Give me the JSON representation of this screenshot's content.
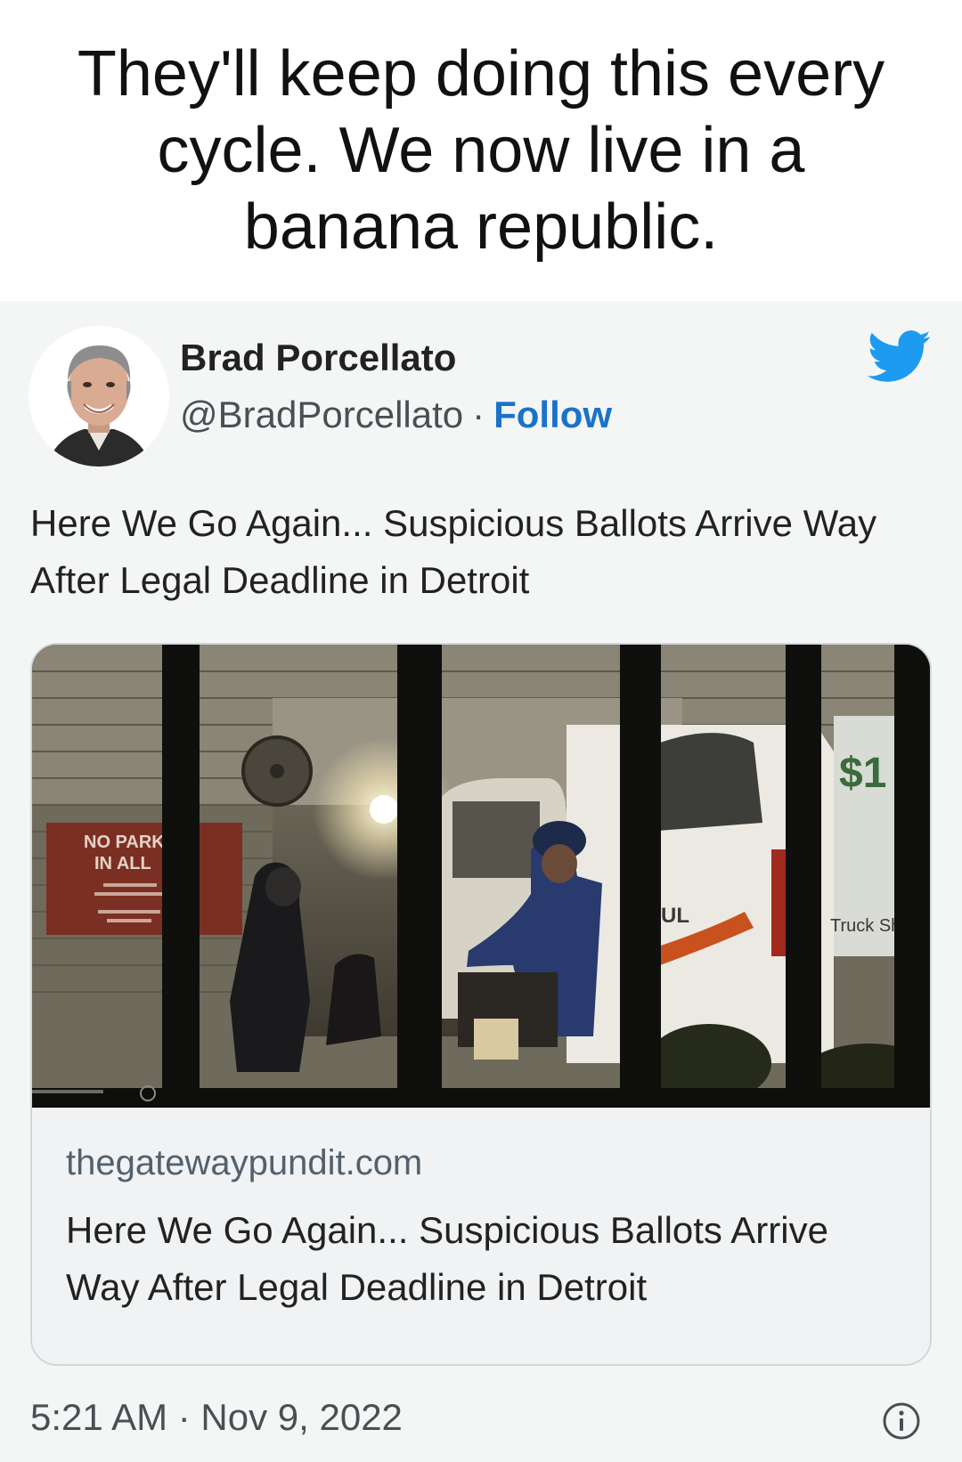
{
  "caption": {
    "text": "They'll keep doing this every cycle. We now live in a banana republic."
  },
  "tweet": {
    "author": {
      "name": "Brad Porcellato",
      "handle": "@BradPorcellato",
      "separator": "·",
      "follow_label": "Follow",
      "avatar_icon": "avatar-photo"
    },
    "brand_icon": "twitter-bird-icon",
    "text": "Here We Go Again... Suspicious Ballots Arrive Way After Legal Deadline in Detroit",
    "card": {
      "domain": "thegatewaypundit.com",
      "title": "Here We Go Again... Suspicious Ballots Arrive Way After Legal Deadline in Detroit",
      "image": {
        "sign_line1": "NO PARK",
        "sign_line2": "IN ALL",
        "truck_sign": "Truck Sh",
        "truck_price": "$1"
      }
    },
    "timestamp": "5:21 AM · Nov 9, 2022",
    "info_icon": "info-icon"
  },
  "colors": {
    "accent": "#1a73c8",
    "twitter_blue": "#1d9bf0",
    "tweet_background": "#f4f6f6",
    "card_border": "#cfd9de"
  }
}
